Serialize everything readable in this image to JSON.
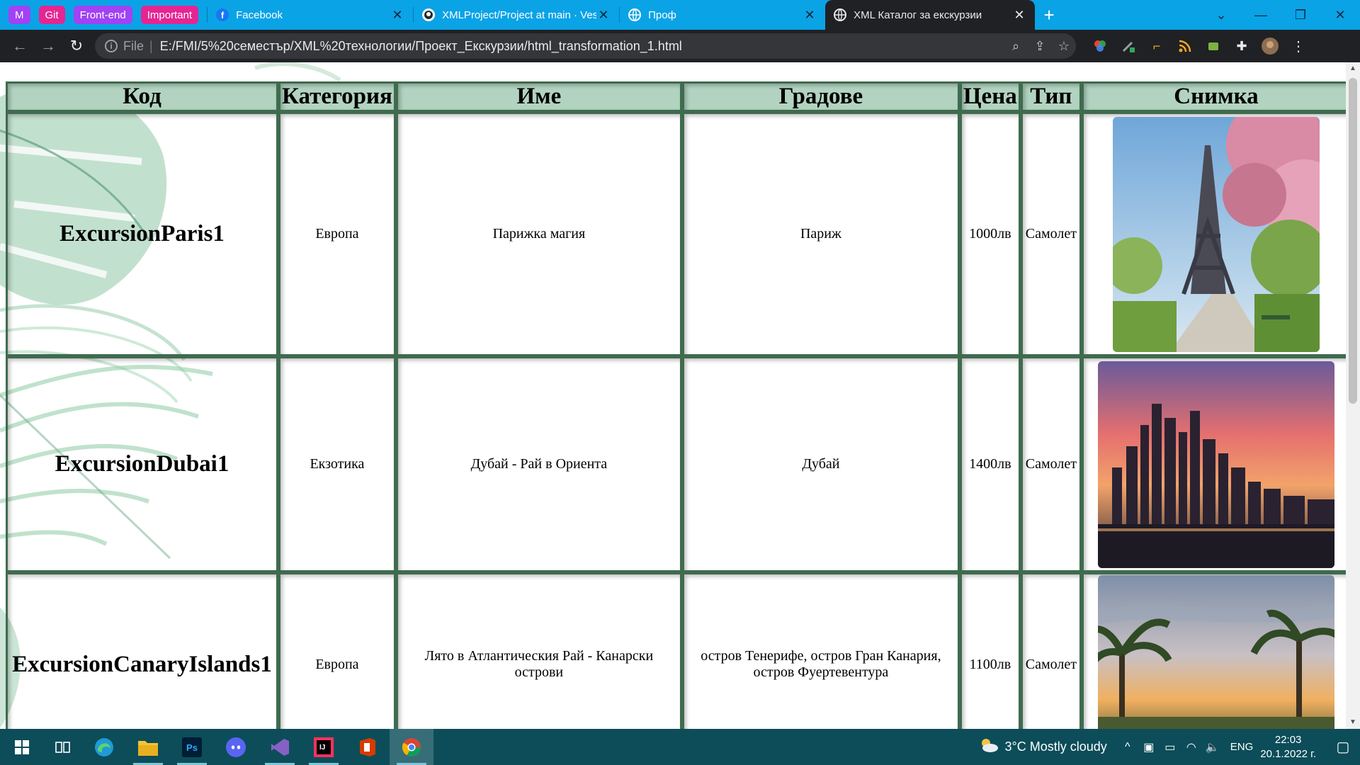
{
  "browser": {
    "tab_groups": [
      {
        "label": "M",
        "color": "#a142f4"
      },
      {
        "label": "Git",
        "color": "#e52592"
      },
      {
        "label": "Front-end",
        "color": "#a142f4"
      },
      {
        "label": "Important",
        "color": "#e52592"
      }
    ],
    "tabs": [
      {
        "title": "Facebook",
        "icon": "facebook-icon"
      },
      {
        "title": "XMLProject/Project at main · Ves",
        "icon": "github-icon"
      },
      {
        "title": "Проф",
        "icon": "globe-icon"
      },
      {
        "title": "XML Каталог за екскурзии",
        "icon": "globe-icon",
        "active": true
      }
    ],
    "address": {
      "scheme": "File",
      "url": "E:/FMI/5%20семестър/XML%20технологии/Проект_Екскурзии/html_transformation_1.html"
    }
  },
  "table": {
    "headers": [
      "Код",
      "Категория",
      "Име",
      "Градове",
      "Цена",
      "Тип",
      "Снимка"
    ],
    "rows": [
      {
        "code": "ExcursionParis1",
        "category": "Европа",
        "name": "Парижка магия",
        "cities": "Париж",
        "price": "1000лв",
        "type": "Самолет",
        "photo": "eiffel-tower-spring-photo"
      },
      {
        "code": "ExcursionDubai1",
        "category": "Екзотика",
        "name": "Дубай - Рай в Ориента",
        "cities": "Дубай",
        "price": "1400лв",
        "type": "Самолет",
        "photo": "dubai-skyline-sunset-photo"
      },
      {
        "code": "ExcursionCanaryIslands1",
        "category": "Европа",
        "name": "Лято в Атлантическия Рай - Канарски острови",
        "cities": "остров Тенерифе, остров Гран Канария, остров Фуертевентура",
        "price": "1100лв",
        "type": "Самолет",
        "photo": "canary-palms-sunset-photo"
      }
    ]
  },
  "taskbar": {
    "weather": "3°C  Mostly cloudy",
    "language": "ENG",
    "time": "22:03",
    "date": "20.1.2022 г."
  }
}
